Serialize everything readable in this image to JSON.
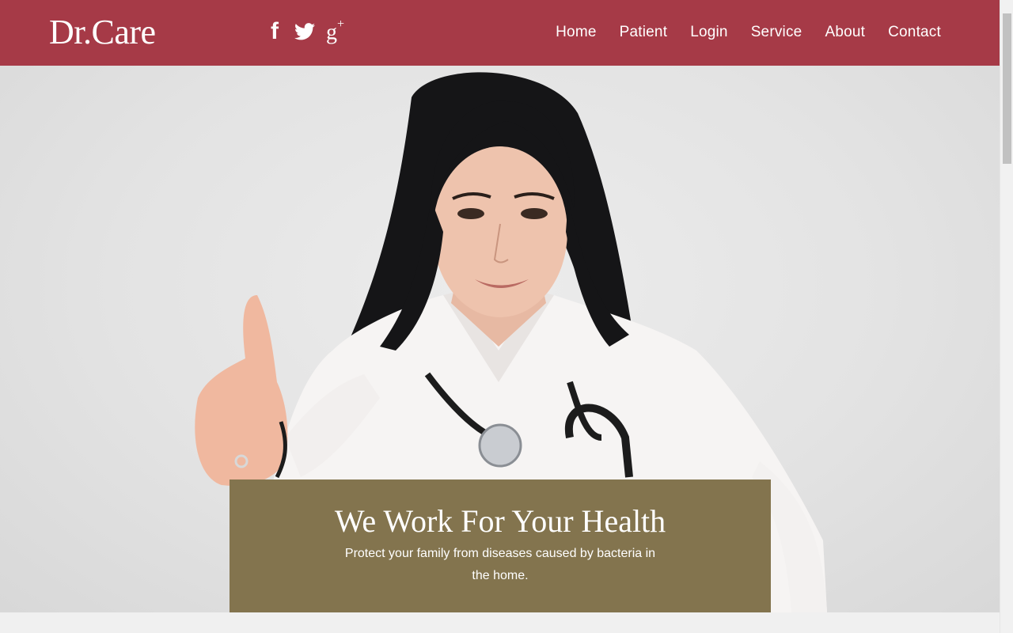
{
  "header": {
    "logo": "Dr.Care",
    "social": [
      {
        "name": "facebook-icon",
        "glyph": "f"
      },
      {
        "name": "twitter-icon",
        "glyph": ""
      },
      {
        "name": "google-plus-icon",
        "glyph": "g",
        "sup": "+"
      }
    ],
    "nav": [
      "Home",
      "Patient",
      "Login",
      "Service",
      "About",
      "Contact"
    ]
  },
  "hero": {
    "title": "We Work For Your Health",
    "text": "Protect your family from diseases caused by bacteria in the home."
  },
  "colors": {
    "header_bg": "#a63a47",
    "caption_bg": "#83744e",
    "page_bg": "#f0f0f0"
  }
}
